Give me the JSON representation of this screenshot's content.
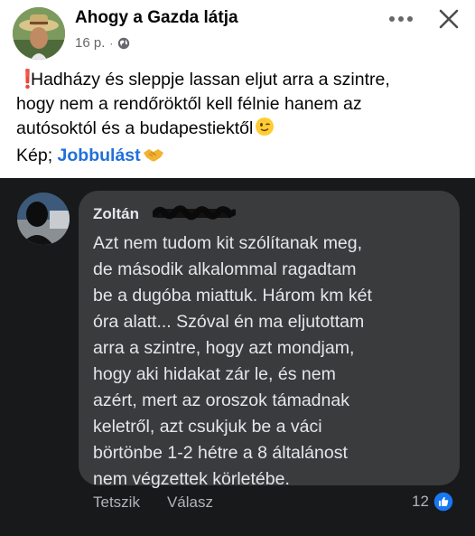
{
  "post": {
    "author_name": "Ahogy a Gazda látja",
    "time_ago": "16 p.",
    "meta_separator": "·",
    "icons": {
      "privacy": "globe-icon",
      "more": "more-dots-icon",
      "close": "close-icon",
      "prefix": "exclamation-icon",
      "wink": "winking-face-emoji",
      "handshake": "handshake-emoji"
    },
    "text_lines": [
      "Hadházy és sleppje lassan eljut arra a szintre,",
      "hogy nem a rendőröktől kell félnie hanem az",
      "autósoktól és a budapestiektől"
    ],
    "caption_prefix": "Kép;",
    "caption_link": "Jobbulást"
  },
  "comment": {
    "author_name": "Zoltán",
    "text_lines": [
      "Azt nem tudom kit szólítanak meg,",
      "de második alkalommal ragadtam",
      "be a dugóba miattuk. Három km két",
      "óra alatt... Szóval én ma eljutottam",
      "arra a szintre, hogy azt mondjam,",
      "hogy aki hidakat zár le, és nem",
      "azért, mert az oroszok támadnak",
      "keletről, azt csukjuk be a váci",
      "börtönbe 1-2 hétre a 8 általánost",
      "nem végzettek körletébe."
    ],
    "actions": {
      "like": "Tetszik",
      "reply": "Válasz"
    },
    "reaction_count": "12",
    "reaction_icon": "like-thumb-icon"
  },
  "colors": {
    "link_blue": "#216fdb",
    "dark_background": "#18191a",
    "bubble": "#3a3b3c",
    "like_blue": "#1877f2",
    "alert_red": "#e0245e"
  }
}
